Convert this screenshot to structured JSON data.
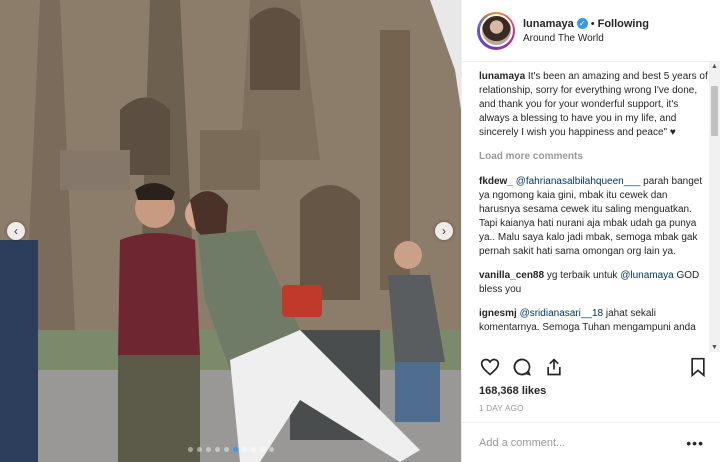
{
  "post": {
    "photo_description_icon": "photo",
    "carousel": {
      "total": 10,
      "active_index": 5
    }
  },
  "header": {
    "username": "lunamaya",
    "separator": "•",
    "follow_status": "Following",
    "location": "Around The World"
  },
  "caption": {
    "username": "lunamaya",
    "text": " It's been an amazing and best 5 years of relationship, sorry for everything wrong I've done, and thank you for your wonderful support, it's always a blessing to have you in my life, and sincerely I wish you happiness and peace\" ♥"
  },
  "load_more": "Load more comments",
  "comments": [
    {
      "username": "fkdew_",
      "mention": "@fahrianasalbilahqueen___",
      "text": " parah banget ya ngomong kaia gini, mbak itu cewek dan harusnya sesama cewek itu saling menguatkan. Tapi kaianya hati nurani aja mbak udah ga punya ya.. Malu saya kalo jadi mbak, semoga mbak gak pernah sakit hati sama omongan org lain ya."
    },
    {
      "username": "vanilla_cen88",
      "pre": " yg terbaik untuk ",
      "mention": "@lunamaya",
      "text": " GOD bless you"
    },
    {
      "username": "ignesmj",
      "mention": "@sridianasari__18",
      "text": " jahat sekali komentarnya. Semoga Tuhan mengampuni anda"
    }
  ],
  "likes": "168,368 likes",
  "date": "1 DAY AGO",
  "add_comment_placeholder": "Add a comment...",
  "more_label": "•••",
  "icons": {
    "like": "heart-icon",
    "comment": "comment-icon",
    "share": "share-icon",
    "save": "bookmark-icon",
    "verified": "verified-badge-icon"
  },
  "colors": {
    "link": "#003569",
    "verified": "#3897f0",
    "muted": "#999999"
  }
}
